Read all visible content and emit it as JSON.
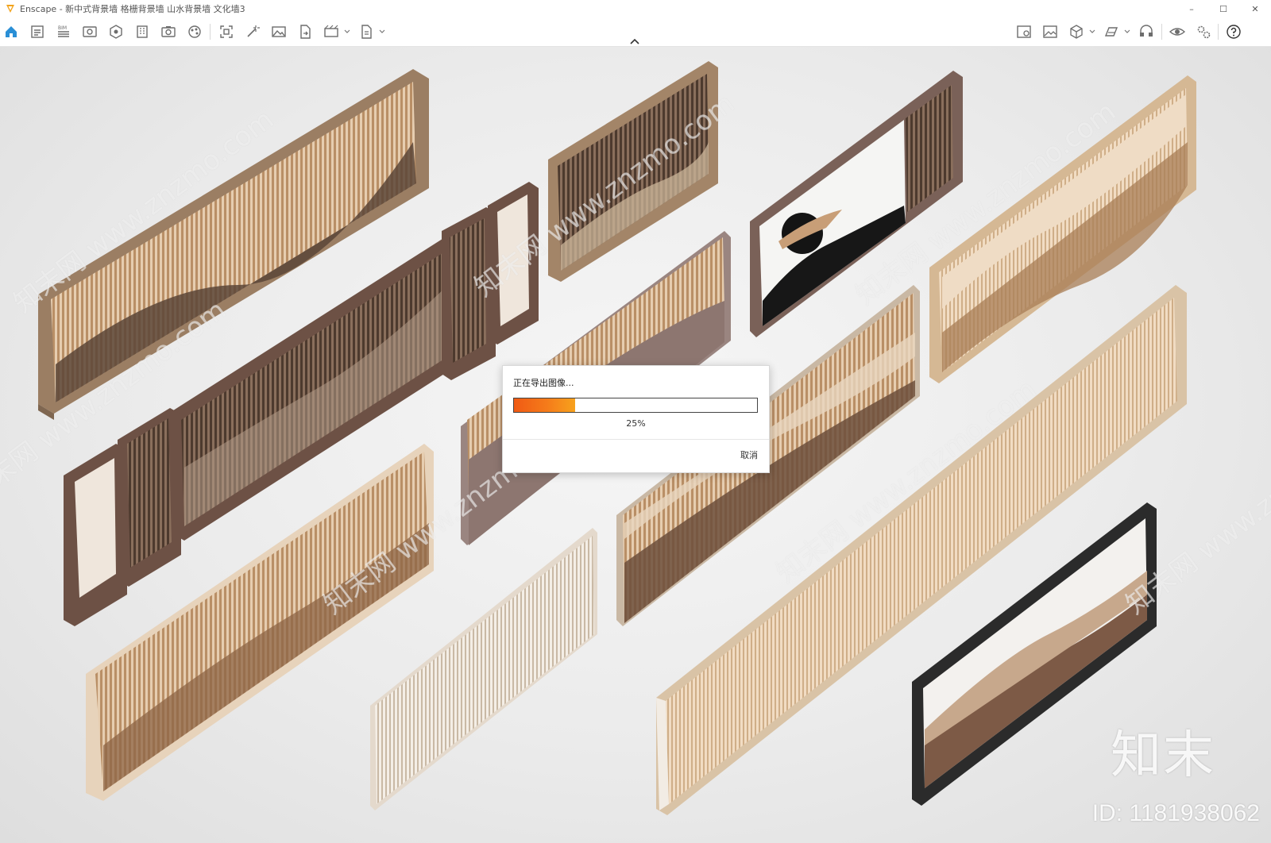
{
  "window": {
    "title": "Enscape - 新中式背景墙 格栅背景墙 山水背景墙 文化墙3",
    "minimize_label": "–",
    "maximize_label": "☐",
    "close_label": "✕"
  },
  "toolbar": {
    "left_icons": [
      "home-icon",
      "document-settings-icon",
      "bim-icon",
      "view-icon",
      "asset-icon",
      "building-icon",
      "camera-library-icon",
      "material-icon",
      "screenshot-icon",
      "magic-icon",
      "render-image-icon",
      "export-icon",
      "video-icon",
      "batch-export-icon"
    ],
    "right_icons": [
      "panorama-icon",
      "image-gallery-icon",
      "cube-icon",
      "vr-icon",
      "headset-icon",
      "eye-icon",
      "settings-icon",
      "help-icon"
    ],
    "bim_label": "BIM"
  },
  "progress_dialog": {
    "message": "正在导出图像...",
    "progress": 0.25,
    "percent_label": "25%",
    "cancel_label": "取消"
  },
  "watermark": {
    "text": "知末网 www.znzmo.com",
    "brand": "知末",
    "id_label": "ID: 1181938062"
  },
  "colors": {
    "accent": "#2a8fd6",
    "progress_start": "#f05a14",
    "progress_end": "#f7a21d"
  }
}
